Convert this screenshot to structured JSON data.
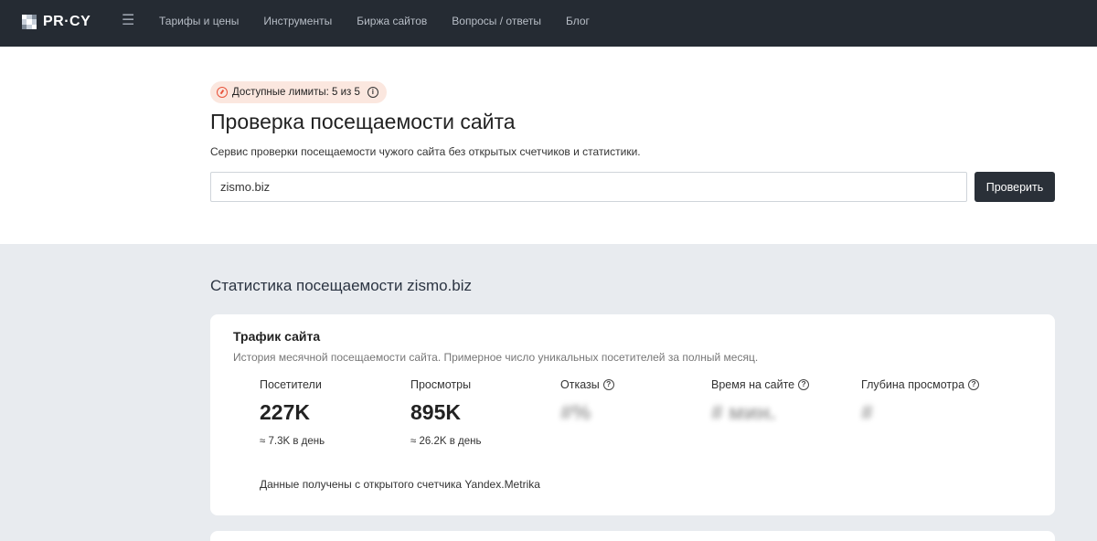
{
  "brand": {
    "name": "PR·CY"
  },
  "nav": {
    "menu_icon": "hamburger-icon",
    "links": [
      "Тарифы и цены",
      "Инструменты",
      "Биржа сайтов",
      "Вопросы / ответы",
      "Блог"
    ]
  },
  "hero": {
    "limit_badge": "Доступные лимиты: 5 из 5",
    "title": "Проверка посещаемости сайта",
    "subtitle": "Сервис проверки посещаемости чужого сайта без открытых счетчиков и статистики.",
    "input_value": "zismo.biz",
    "button_label": "Проверить"
  },
  "stats": {
    "section_title": "Статистика посещаемости zismo.biz",
    "card": {
      "title": "Трафик сайта",
      "subtitle": "История месячной посещаемости сайта. Примерное число уникальных посетителей за полный месяц.",
      "metrics": [
        {
          "label": "Посетители",
          "value": "227K",
          "sub": "≈ 7.3K в день"
        },
        {
          "label": "Просмотры",
          "value": "895K",
          "sub": "≈ 26.2K в день"
        },
        {
          "label": "Отказы",
          "value": "#%",
          "sub": ""
        },
        {
          "label": "Время на сайте",
          "value": "# мин.",
          "sub": ""
        },
        {
          "label": "Глубина просмотра",
          "value": "#",
          "sub": ""
        }
      ],
      "note": "Данные получены с открытого счетчика Yandex.Metrika"
    }
  },
  "colors": {
    "navbar": "#252b33",
    "badge_bg": "#fbe7df",
    "accent": "#e8533b",
    "button": "#2a3038",
    "page_bg": "#e8ebef"
  }
}
